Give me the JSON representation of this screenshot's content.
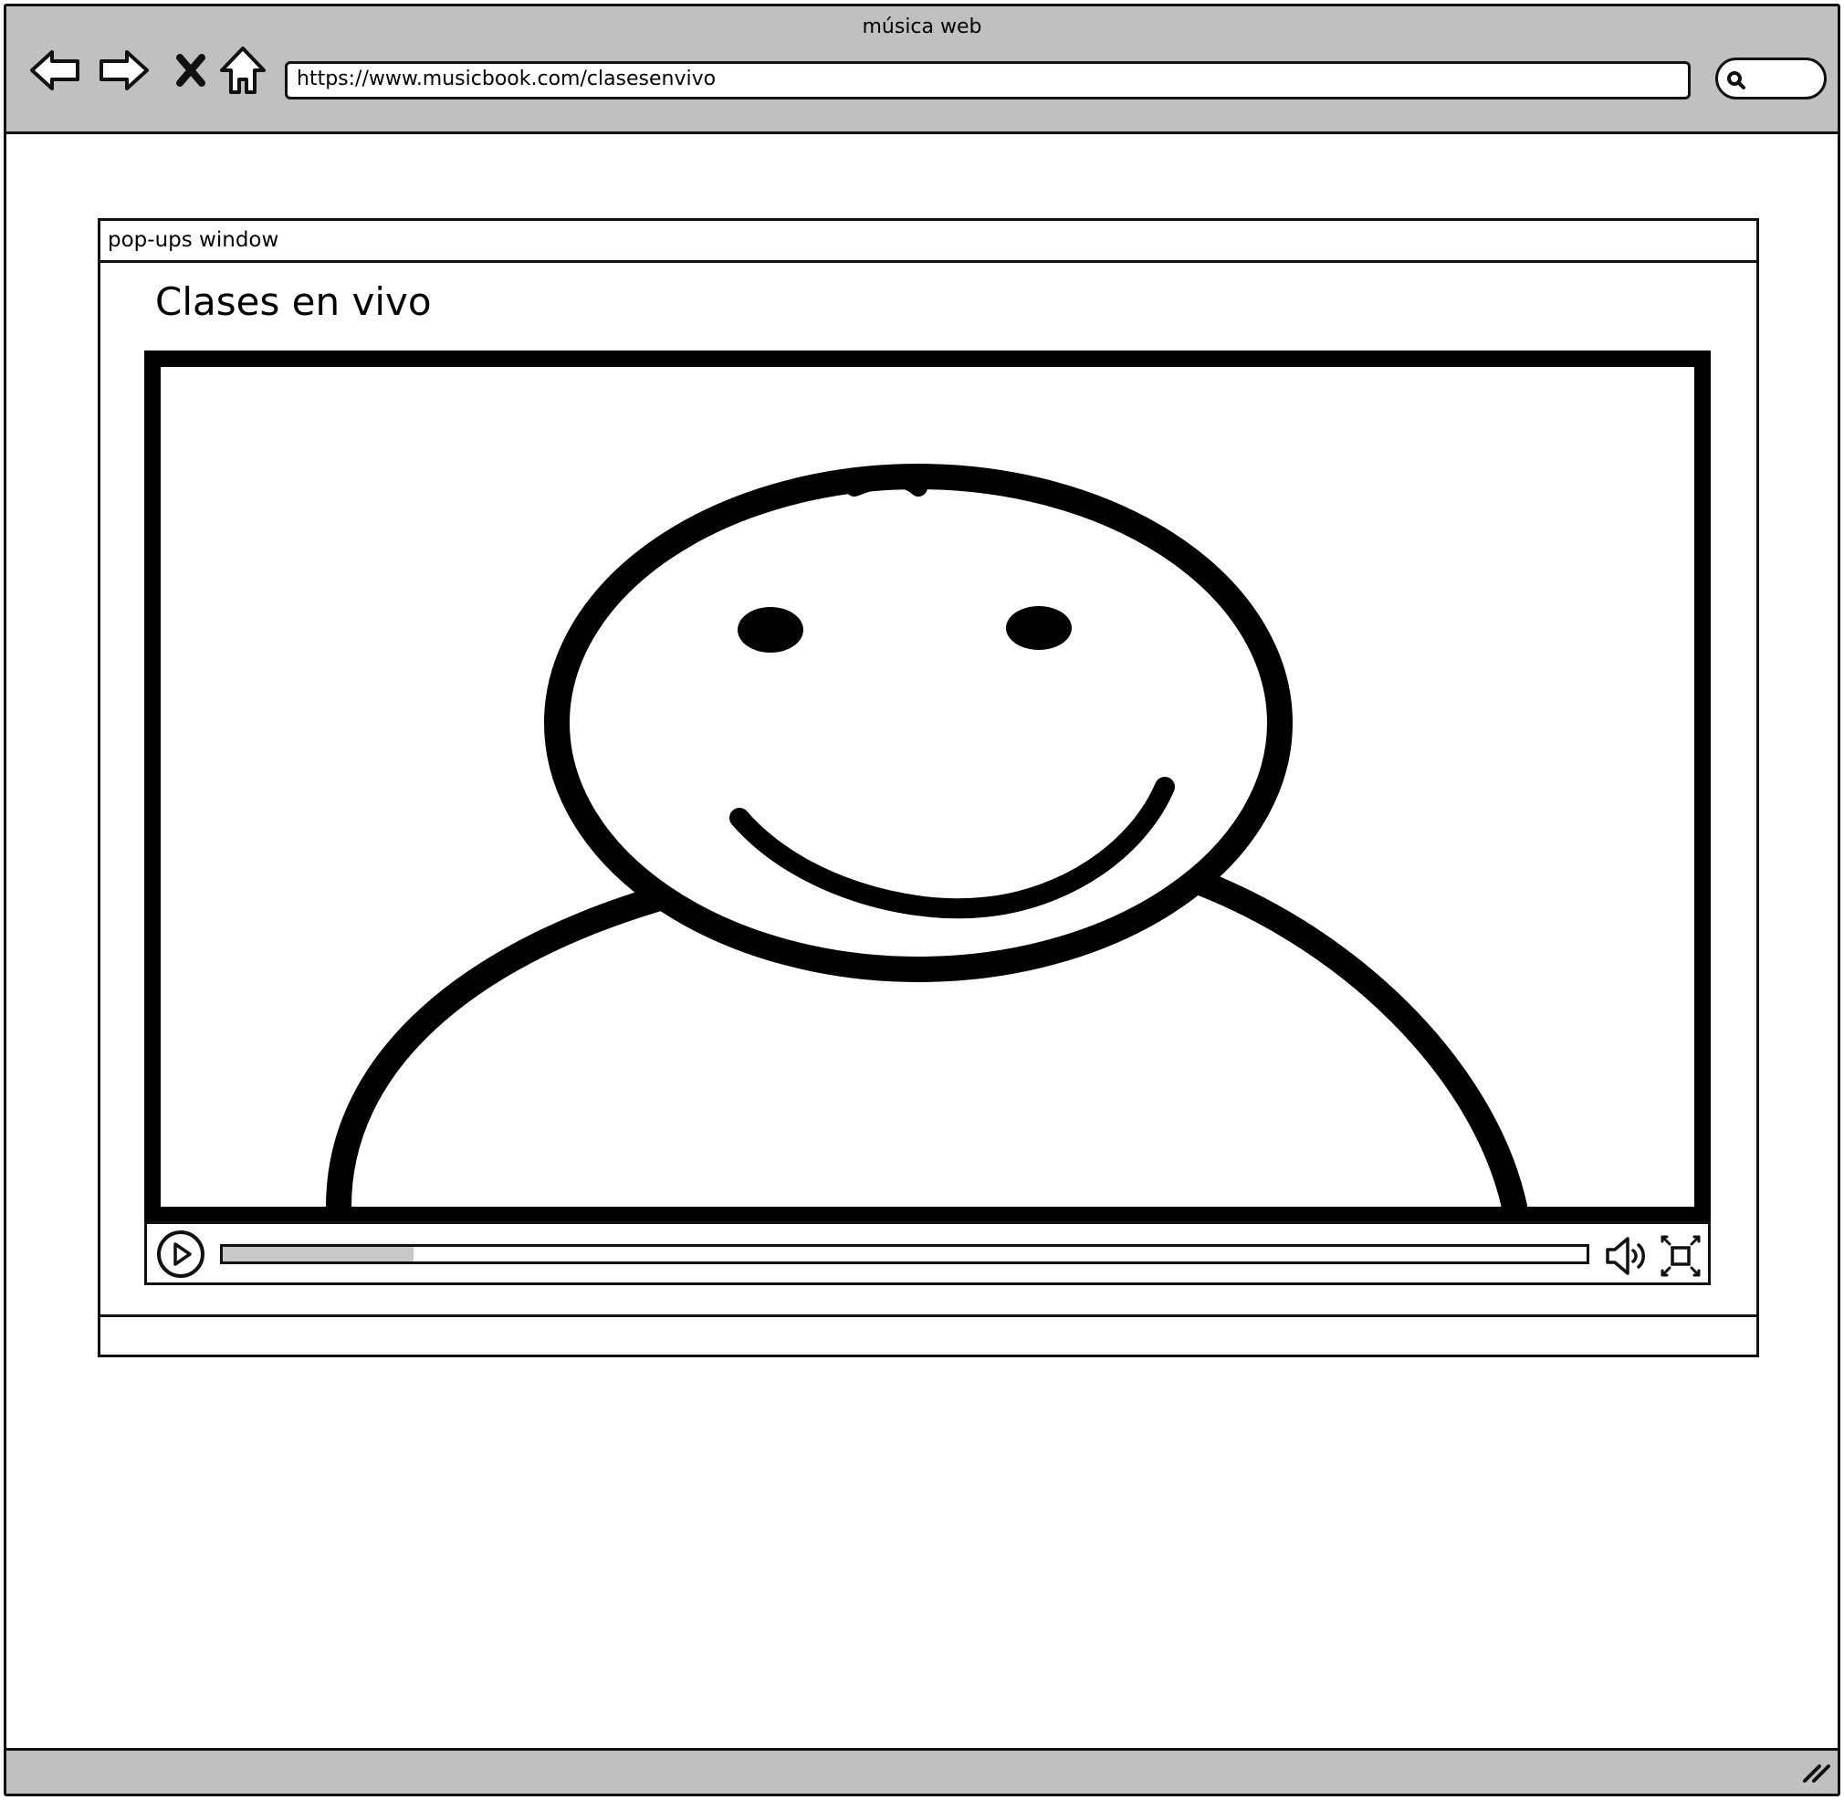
{
  "window": {
    "title": "música web"
  },
  "toolbar": {
    "back_icon": "arrow-left-icon",
    "forward_icon": "arrow-right-icon",
    "stop_icon": "close-icon",
    "home_icon": "home-icon",
    "url": "https://www.musicbook.com/clasesenvivo",
    "search_icon": "search-icon"
  },
  "popup": {
    "header_title": "pop-ups window",
    "heading": "Clases en vivo"
  },
  "video_player": {
    "placeholder_image": "person-avatar-placeholder",
    "play_icon": "play-icon",
    "progress": 0.14,
    "volume_icon": "volume-icon",
    "fullscreen_icon": "fullscreen-icon"
  },
  "colors": {
    "chrome_gray": "#c0c0c0",
    "progress_fill": "#c8c8c8",
    "line": "#111111"
  }
}
